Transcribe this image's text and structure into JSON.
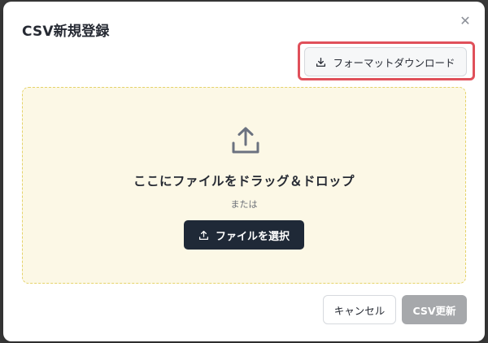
{
  "dialog": {
    "title": "CSV新規登録",
    "close_icon": "close-icon",
    "close_glyph": "✕"
  },
  "format_download": {
    "label": "フォーマットダウンロード",
    "icon": "download-icon",
    "highlight_color": "#e0505a"
  },
  "dropzone": {
    "icon": "upload-icon",
    "title": "ここにファイルをドラッグ＆ドロップ",
    "or_text": "または",
    "select_button": {
      "label": "ファイルを選択",
      "icon": "upload-icon"
    },
    "background_color": "#fcf8e6",
    "border_color": "#e5d36a"
  },
  "footer": {
    "cancel_label": "キャンセル",
    "submit_label": "CSV更新",
    "submit_disabled": true
  }
}
